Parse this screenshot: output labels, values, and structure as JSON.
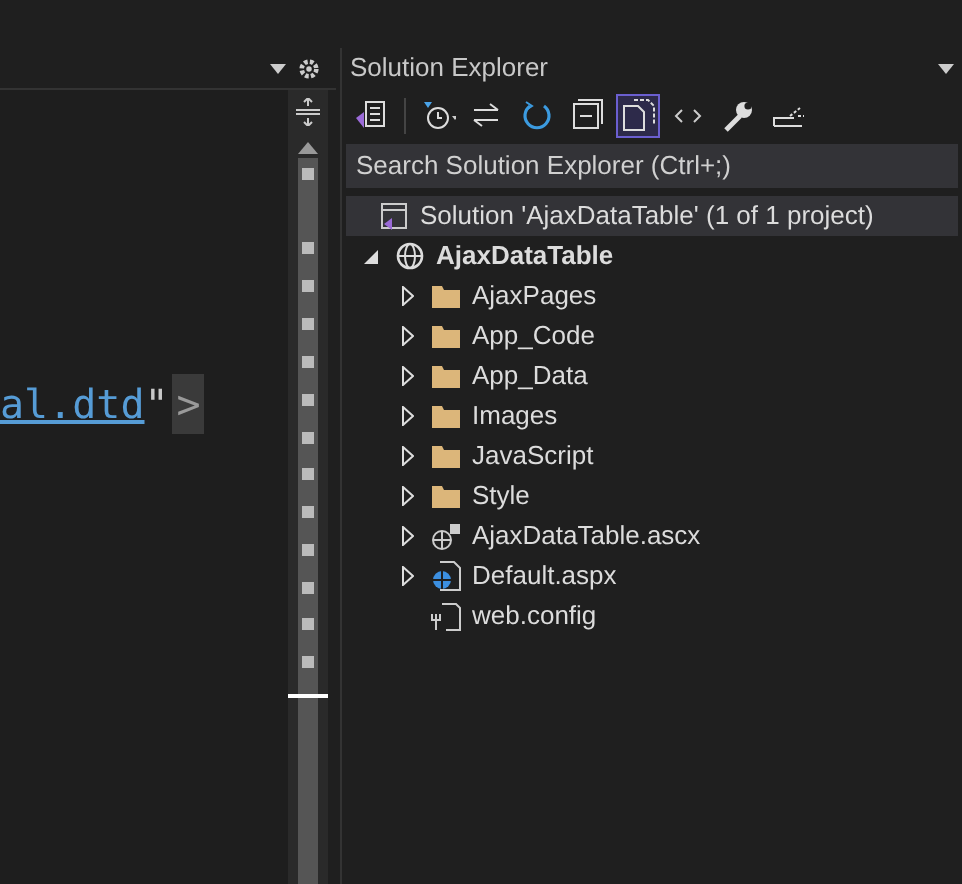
{
  "editor": {
    "code_line": [
      {
        "kind": "link",
        "text": "al.dtd"
      },
      {
        "kind": "quote",
        "text": "\""
      },
      {
        "kind": "matched-bracket",
        "text": ">"
      }
    ]
  },
  "solution_explorer": {
    "title": "Solution Explorer",
    "search": {
      "placeholder": "Search Solution Explorer (Ctrl+;)"
    },
    "toolbar": [
      {
        "kind": "home",
        "selected": false
      },
      {
        "kind": "pending",
        "selected": false
      },
      {
        "kind": "sync",
        "selected": false
      },
      {
        "kind": "refresh",
        "selected": false
      },
      {
        "kind": "collapse",
        "selected": false
      },
      {
        "kind": "show-all",
        "selected": true
      },
      {
        "kind": "code",
        "selected": false
      },
      {
        "kind": "properties",
        "selected": false
      },
      {
        "kind": "preview",
        "selected": false
      }
    ],
    "tree": [
      {
        "kind": "solution",
        "label": "Solution 'AjaxDataTable' (1 of 1 project)",
        "selected": true,
        "children": [
          {
            "kind": "web-project",
            "label": "AjaxDataTable",
            "selected": false,
            "expanded": true,
            "children": [
              {
                "kind": "folder",
                "label": "AjaxPages",
                "selected": false,
                "expanded": false
              },
              {
                "kind": "folder",
                "label": "App_Code",
                "selected": false,
                "expanded": false
              },
              {
                "kind": "folder",
                "label": "App_Data",
                "selected": false,
                "expanded": false
              },
              {
                "kind": "folder",
                "label": "Images",
                "selected": false,
                "expanded": false
              },
              {
                "kind": "folder",
                "label": "JavaScript",
                "selected": false,
                "expanded": false
              },
              {
                "kind": "folder",
                "label": "Style",
                "selected": false,
                "expanded": false
              },
              {
                "kind": "user-control",
                "label": "AjaxDataTable.ascx",
                "selected": false,
                "expanded": false
              },
              {
                "kind": "web-form",
                "label": "Default.aspx",
                "selected": false,
                "expanded": false
              },
              {
                "kind": "config",
                "label": "web.config",
                "selected": false
              }
            ]
          }
        ]
      }
    ]
  }
}
